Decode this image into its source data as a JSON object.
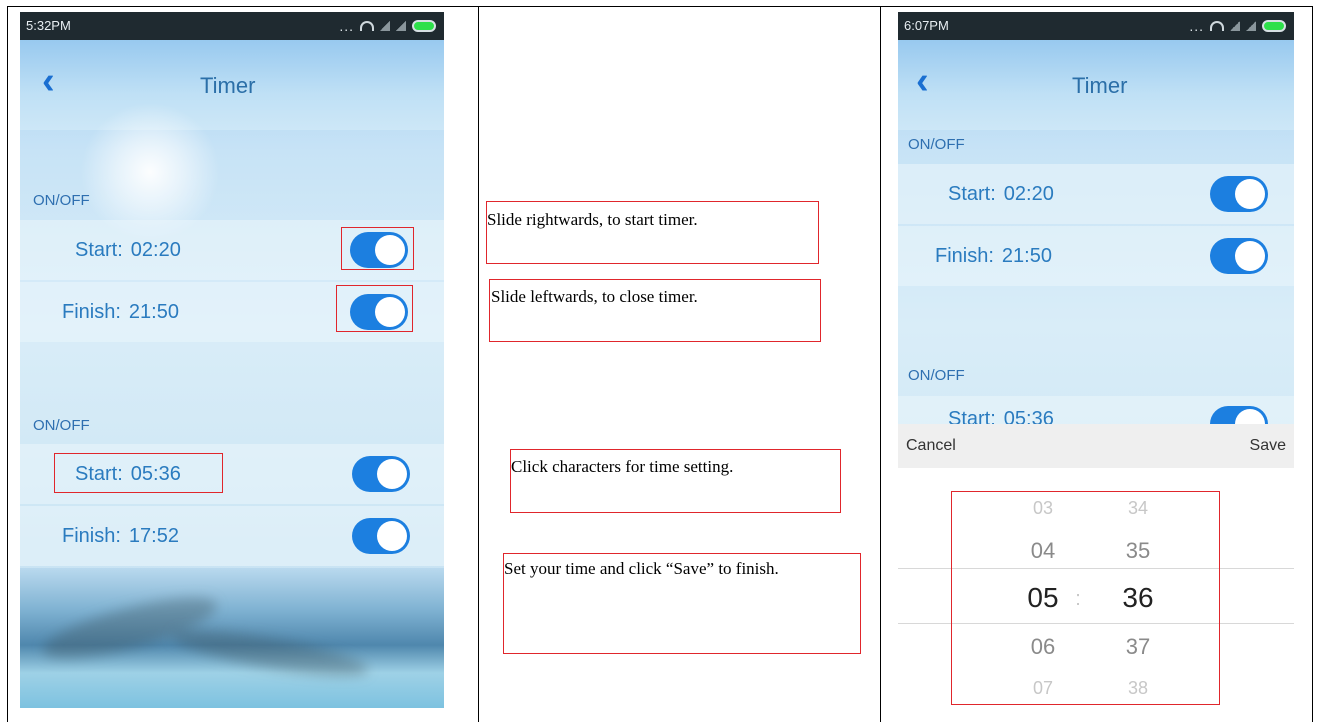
{
  "left_screen": {
    "status": {
      "time": "5:32PM",
      "dots": "..."
    },
    "header": {
      "title": "Timer"
    },
    "groups": [
      {
        "label": "ON/OFF",
        "rows": [
          {
            "label": "Start:",
            "time": "02:20"
          },
          {
            "label": "Finish:",
            "time": "21:50"
          }
        ]
      },
      {
        "label": "ON/OFF",
        "rows": [
          {
            "label": "Start:",
            "time": "05:36"
          },
          {
            "label": "Finish:",
            "time": "17:52"
          }
        ]
      }
    ]
  },
  "notes": [
    "Slide rightwards, to start timer.",
    "Slide leftwards, to close timer.",
    "Click characters for time setting.",
    "Set your time and click “Save” to finish."
  ],
  "right_screen": {
    "status": {
      "time": "6:07PM",
      "dots": "..."
    },
    "header": {
      "title": "Timer"
    },
    "groups": [
      {
        "label": "ON/OFF",
        "rows": [
          {
            "label": "Start:",
            "time": "02:20"
          },
          {
            "label": "Finish:",
            "time": "21:50"
          }
        ]
      },
      {
        "label": "ON/OFF",
        "rows": [
          {
            "label": "Start:",
            "time": "05:36"
          }
        ]
      }
    ],
    "picker": {
      "cancel": "Cancel",
      "save": "Save",
      "separator": ":",
      "hours": [
        "03",
        "04",
        "05",
        "06",
        "07"
      ],
      "minutes": [
        "34",
        "35",
        "36",
        "37",
        "38"
      ]
    }
  },
  "colors": {
    "accent": "#1c7fe0",
    "annotation": "#e0262c",
    "label": "#2a7bbf"
  },
  "icons": [
    "back-icon",
    "wifi-icon",
    "signal-icon",
    "battery-icon",
    "toggle-switch"
  ]
}
